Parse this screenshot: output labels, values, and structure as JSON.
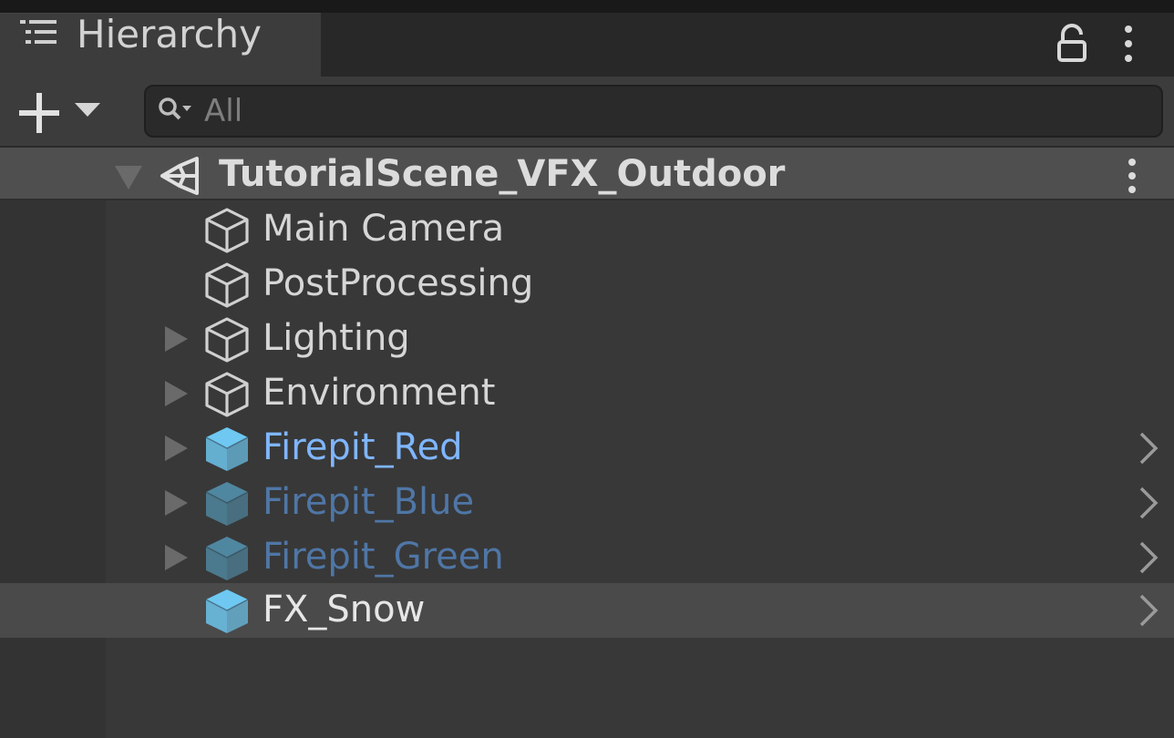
{
  "window": {
    "tab_title": "Hierarchy",
    "tab_icon": "list-icon",
    "lock_icon": "lock-icon",
    "menu_icon": "kebab-menu-icon"
  },
  "toolbar": {
    "add_icon": "plus-icon",
    "search": {
      "placeholder": "All",
      "value": ""
    }
  },
  "scene": {
    "name": "TutorialScene_VFX_Outdoor",
    "icon": "unity-scene-icon",
    "expanded": true
  },
  "items": [
    {
      "label": "Main Camera",
      "has_children": false,
      "type": "gameobject",
      "prefab_arrow": false,
      "selected": false
    },
    {
      "label": "PostProcessing",
      "has_children": false,
      "type": "gameobject",
      "prefab_arrow": false,
      "selected": false
    },
    {
      "label": "Lighting",
      "has_children": true,
      "type": "gameobject",
      "prefab_arrow": false,
      "selected": false
    },
    {
      "label": "Environment",
      "has_children": true,
      "type": "gameobject",
      "prefab_arrow": false,
      "selected": false
    },
    {
      "label": "Firepit_Red",
      "has_children": true,
      "type": "prefab",
      "prefab_arrow": true,
      "selected": false
    },
    {
      "label": "Firepit_Blue",
      "has_children": true,
      "type": "prefab-inactive",
      "prefab_arrow": true,
      "selected": false
    },
    {
      "label": "Firepit_Green",
      "has_children": true,
      "type": "prefab-inactive",
      "prefab_arrow": true,
      "selected": false
    },
    {
      "label": "FX_Snow",
      "has_children": false,
      "type": "prefab",
      "prefab_arrow": true,
      "selected": true
    }
  ],
  "colors": {
    "panel_bg": "#383838",
    "tab_bg": "#3c3c3c",
    "scene_row_bg": "#4f4f4f",
    "selected_row_bg": "#4a4a4a",
    "text_default": "#d6d6d6",
    "text_prefab": "#7fb6ff",
    "text_prefab_inactive": "#4f76a6",
    "text_selected": "#e6e6e6",
    "cube_prefab": "#6ec8f2",
    "cube_prefab_inactive": "#4f87a0"
  }
}
